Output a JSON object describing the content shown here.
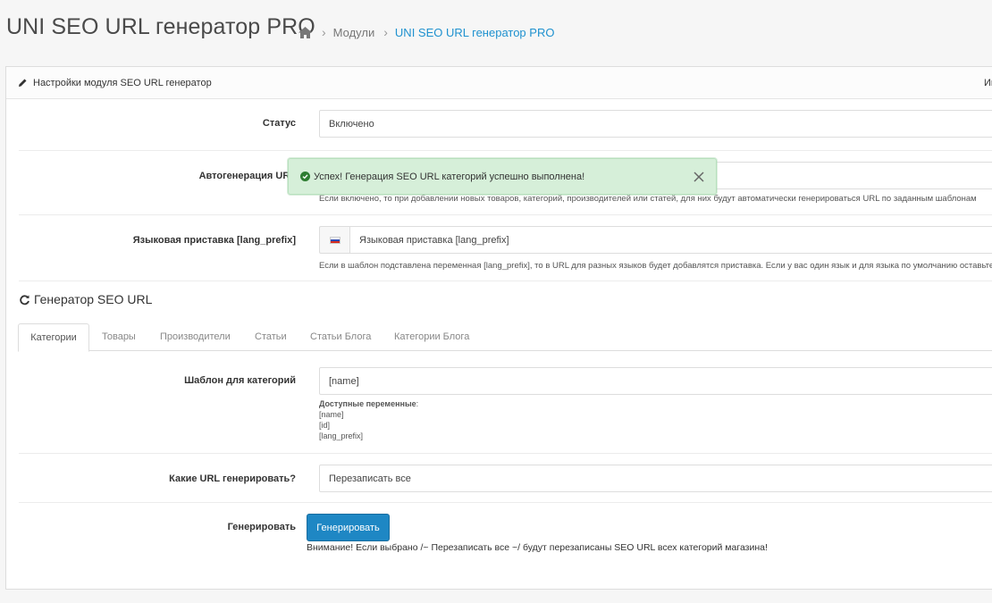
{
  "header": {
    "title": "UNI SEO URL генератор PRO",
    "breadcrumbs": [
      {
        "label": "Модули"
      },
      {
        "label": "UNI SEO URL генератор PRO"
      }
    ]
  },
  "panel": {
    "title": "Настройки модуля SEO URL генератор",
    "right_text": "Ин"
  },
  "settings": {
    "status": {
      "label": "Статус",
      "value": "Включено"
    },
    "autogen": {
      "label": "Автогенерация URL",
      "help": "Если включено, то при добавлении новых товаров, категорий, производителей или статей, для них будут автоматически генерироваться URL по заданным шаблонам"
    },
    "lang_prefix": {
      "label": "Языковая приставка [lang_prefix]",
      "placeholder": "Языковая приставка [lang_prefix]",
      "help": "Если в шаблон подставлена переменная [lang_prefix], то в URL для разных языков будет добавлятся приставка. Если у вас один язык и для языка по умолчанию оставьте пол"
    }
  },
  "generator": {
    "title": "Генератор SEO URL",
    "tabs": [
      "Категории",
      "Товары",
      "Производители",
      "Статьи",
      "Статьи Блога",
      "Категории Блога"
    ],
    "template": {
      "label": "Шаблон для категорий",
      "value": "[name]",
      "vars_title": "Доступные переменные",
      "vars_colon": ":",
      "vars": [
        "[name]",
        "[id]",
        "[lang_prefix]"
      ]
    },
    "which_urls": {
      "label": "Какие URL генерировать?",
      "value": "Перезаписать все"
    },
    "generate": {
      "label": "Генерировать",
      "button": "Генерировать",
      "warning": "Внимание! Если выбрано /~ Перезаписать все ~/ будут перезаписаны SEO URL всех категорий магазина!"
    }
  },
  "alert": {
    "text": "Успех! Генерация SEO URL категорий успешно выполнена!"
  },
  "colors": {
    "accent": "#1e91cf",
    "button": "#1e87c4",
    "alert_bg": "#d6efd9",
    "success": "#3c763d"
  },
  "icons": [
    "home-icon",
    "pencil-icon",
    "refresh-icon",
    "check-circle-icon",
    "close-icon",
    "flag-ru-icon"
  ]
}
